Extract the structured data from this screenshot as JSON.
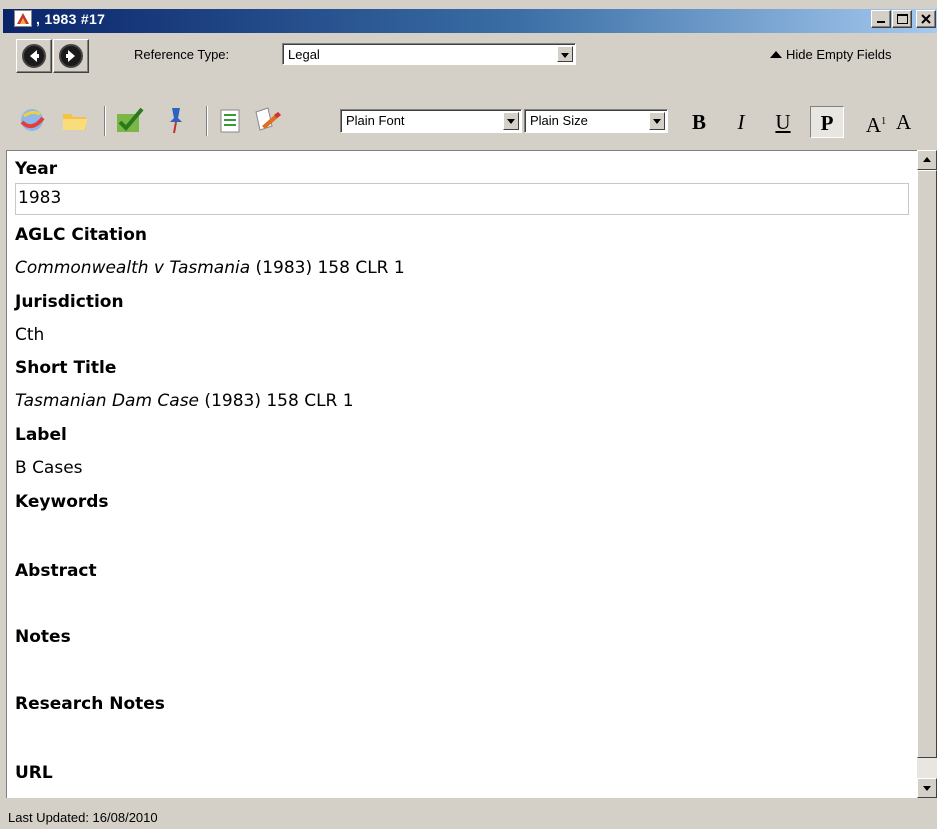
{
  "window": {
    "title": ", 1983 #17"
  },
  "toolbar": {
    "reference_type_label": "Reference Type:",
    "reference_type_value": "Legal",
    "hide_empty_label": "Hide Empty Fields",
    "font_value": "Plain Font",
    "size_value": "Plain Size",
    "bold": "B",
    "italic": "I",
    "underline": "U",
    "plain": "P",
    "superscript": "A",
    "superscript_mark": "1",
    "subscript": "A"
  },
  "fields": {
    "year": {
      "label": "Year",
      "value": "1983"
    },
    "citation": {
      "label": "AGLC Citation",
      "value_italic": "Commonwealth v Tasmania",
      "value_rest": " (1983) 158 CLR 1"
    },
    "jurisdiction": {
      "label": "Jurisdiction",
      "value": "Cth"
    },
    "short_title": {
      "label": "Short Title",
      "value_italic": "Tasmanian Dam Case",
      "value_rest": " (1983) 158 CLR 1"
    },
    "label": {
      "label": "Label",
      "value": "B Cases"
    },
    "keywords": {
      "label": "Keywords"
    },
    "abstract": {
      "label": "Abstract"
    },
    "notes": {
      "label": "Notes"
    },
    "research_notes": {
      "label": "Research Notes"
    },
    "url": {
      "label": "URL"
    }
  },
  "status": {
    "text": "Last Updated: 16/08/2010"
  },
  "colors": {
    "title_start": "#0a246a",
    "title_end": "#a6caf0",
    "face": "#d4d0c8"
  }
}
